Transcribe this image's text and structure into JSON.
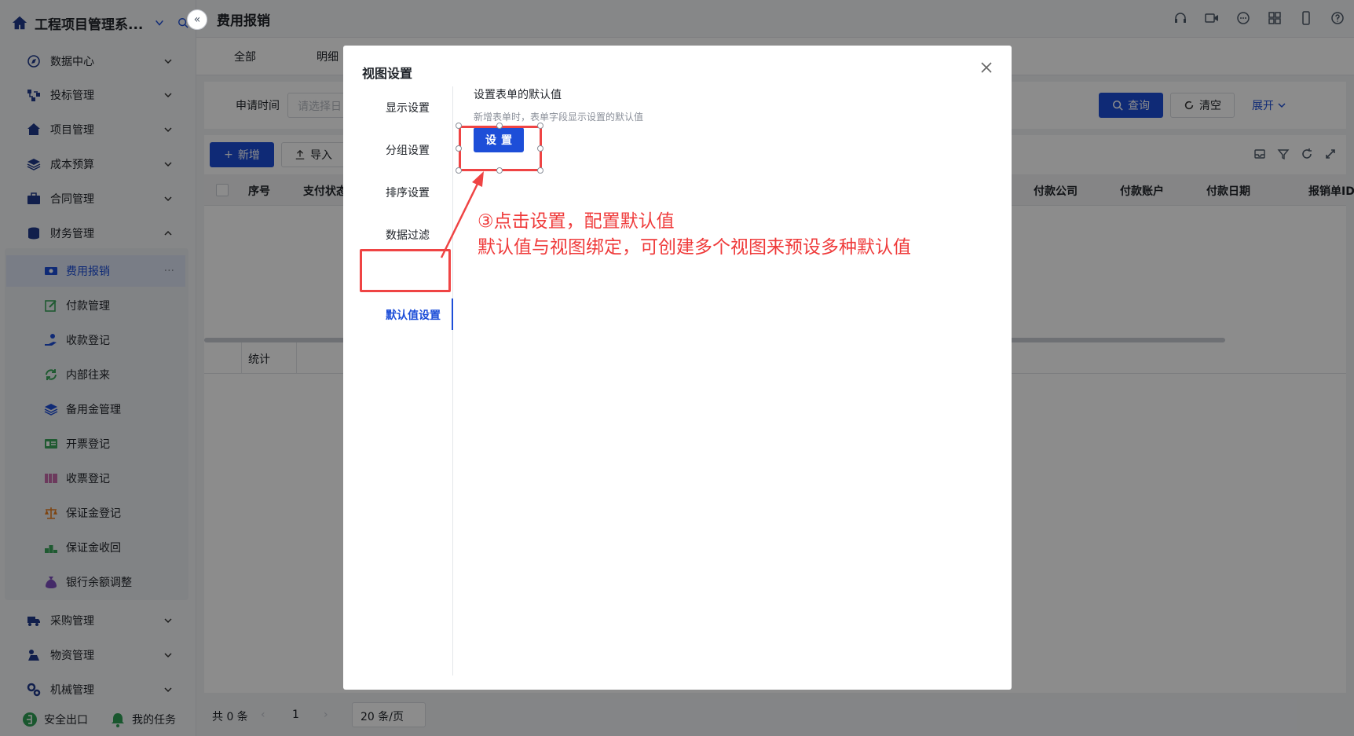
{
  "app": {
    "title": "工程项目管理系..."
  },
  "sidebar": {
    "menus": [
      {
        "label": "数据中心"
      },
      {
        "label": "投标管理"
      },
      {
        "label": "项目管理"
      },
      {
        "label": "成本预算"
      },
      {
        "label": "合同管理"
      },
      {
        "label": "财务管理"
      }
    ],
    "submenus": [
      {
        "label": "费用报销",
        "more": "···"
      },
      {
        "label": "付款管理"
      },
      {
        "label": "收款登记"
      },
      {
        "label": "内部往来"
      },
      {
        "label": "备用金管理"
      },
      {
        "label": "开票登记"
      },
      {
        "label": "收票登记"
      },
      {
        "label": "保证金登记"
      },
      {
        "label": "保证金收回"
      },
      {
        "label": "银行余额调整"
      }
    ],
    "menus_after": [
      {
        "label": "采购管理"
      },
      {
        "label": "物资管理"
      },
      {
        "label": "机械管理"
      }
    ],
    "bottom": {
      "exit": "安全出口",
      "tasks": "我的任务"
    }
  },
  "header": {
    "page_title": "费用报销"
  },
  "tabs": [
    {
      "label": "全部"
    },
    {
      "label": "明细"
    }
  ],
  "filter": {
    "date_label": "申请时间",
    "date_placeholder": "请选择日",
    "query_button": "查询",
    "clear_button": "清空",
    "expand_link": "展开"
  },
  "toolbar": {
    "add_button": "新增",
    "import_button": "导入"
  },
  "table": {
    "columns_left": [
      {
        "label": "序号"
      },
      {
        "label": "支付状态"
      }
    ],
    "columns_right": [
      {
        "label": "付款公司"
      },
      {
        "label": "付款账户"
      },
      {
        "label": "付款日期"
      },
      {
        "label": "报销单ID"
      }
    ],
    "summary_label": "统计"
  },
  "pagination": {
    "total": "共 0 条",
    "page": "1",
    "page_size": "20 条/页"
  },
  "modal": {
    "title": "视图设置",
    "nav": [
      {
        "label": "显示设置"
      },
      {
        "label": "分组设置"
      },
      {
        "label": "排序设置"
      },
      {
        "label": "数据过滤"
      },
      {
        "label": "默认值设置"
      }
    ],
    "content_title": "设置表单的默认值",
    "content_hint": "新增表单时，表单字段显示设置的默认值",
    "set_button": "设置"
  },
  "annotation": {
    "line1": "③点击设置，配置默认值",
    "line2": "默认值与视图绑定，可创建多个视图来预设多种默认值"
  },
  "colors": {
    "accent": "#1d4ed8",
    "highlight": "#ef4444"
  }
}
